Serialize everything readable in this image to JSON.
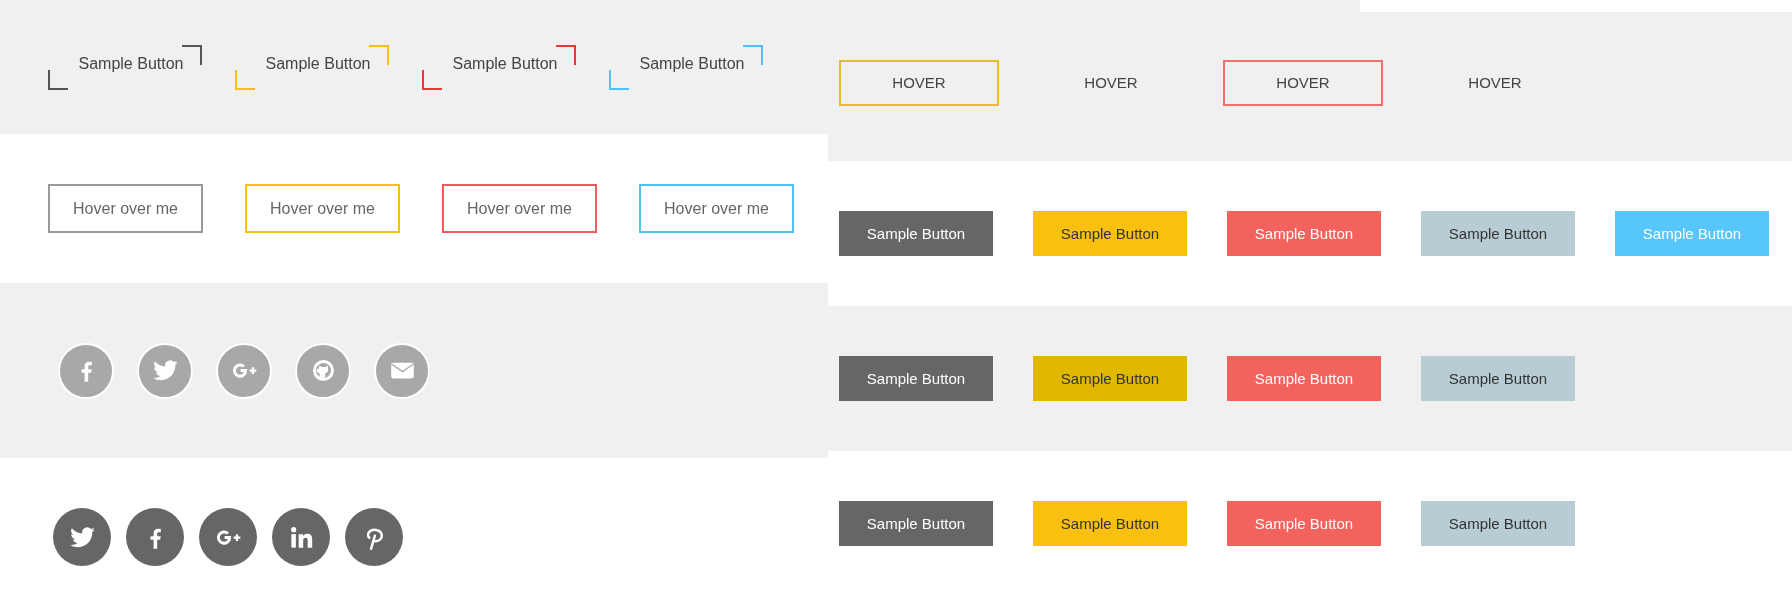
{
  "corner_buttons": [
    {
      "label": "Sample Button",
      "color": "#555555"
    },
    {
      "label": "Sample Button",
      "color": "#f9bf15"
    },
    {
      "label": "Sample Button",
      "color": "#e53935"
    },
    {
      "label": "Sample Button",
      "color": "#4fc3f7"
    }
  ],
  "outline_buttons": [
    {
      "label": "Hover over me",
      "color": "#999999"
    },
    {
      "label": "Hover over me",
      "color": "#f9bf15"
    },
    {
      "label": "Hover over me",
      "color": "#f05a5a"
    },
    {
      "label": "Hover over me",
      "color": "#4fc3f7"
    }
  ],
  "social_light": [
    {
      "kind": "facebook"
    },
    {
      "kind": "twitter"
    },
    {
      "kind": "googleplus"
    },
    {
      "kind": "github"
    },
    {
      "kind": "mail"
    }
  ],
  "social_dark": [
    {
      "kind": "twitter"
    },
    {
      "kind": "facebook"
    },
    {
      "kind": "googleplus"
    },
    {
      "kind": "linkedin"
    },
    {
      "kind": "pinterest"
    }
  ],
  "hover_buttons": [
    {
      "label": "HOVER",
      "outlined": true,
      "color": "#e8bd2a"
    },
    {
      "label": "HOVER",
      "outlined": false
    },
    {
      "label": "HOVER",
      "outlined": true,
      "color": "#f0706b"
    },
    {
      "label": "HOVER",
      "outlined": false
    }
  ],
  "filled_rows": [
    {
      "buttons": [
        {
          "label": "Sample Button",
          "color": "#666666",
          "dark_text": false
        },
        {
          "label": "Sample Button",
          "color": "#f9c00f",
          "dark_text": true
        },
        {
          "label": "Sample Button",
          "color": "#f3635d",
          "dark_text": false
        },
        {
          "label": "Sample Button",
          "color": "#b8cdd3",
          "dark_text": true
        },
        {
          "label": "Sample Button",
          "color": "#57c6fd",
          "dark_text": false
        }
      ]
    },
    {
      "buttons": [
        {
          "label": "Sample Button",
          "color": "#666666",
          "dark_text": false
        },
        {
          "label": "Sample Button",
          "color": "#e0b800",
          "dark_text": true
        },
        {
          "label": "Sample Button",
          "color": "#f3635d",
          "dark_text": false
        },
        {
          "label": "Sample Button",
          "color": "#b8cdd3",
          "dark_text": true
        }
      ]
    },
    {
      "buttons": [
        {
          "label": "Sample Button",
          "color": "#666666",
          "dark_text": false
        },
        {
          "label": "Sample Button",
          "color": "#f9c00f",
          "dark_text": true
        },
        {
          "label": "Sample Button",
          "color": "#f3635d",
          "dark_text": false
        },
        {
          "label": "Sample Button",
          "color": "#b8cdd3",
          "dark_text": true
        }
      ]
    }
  ]
}
